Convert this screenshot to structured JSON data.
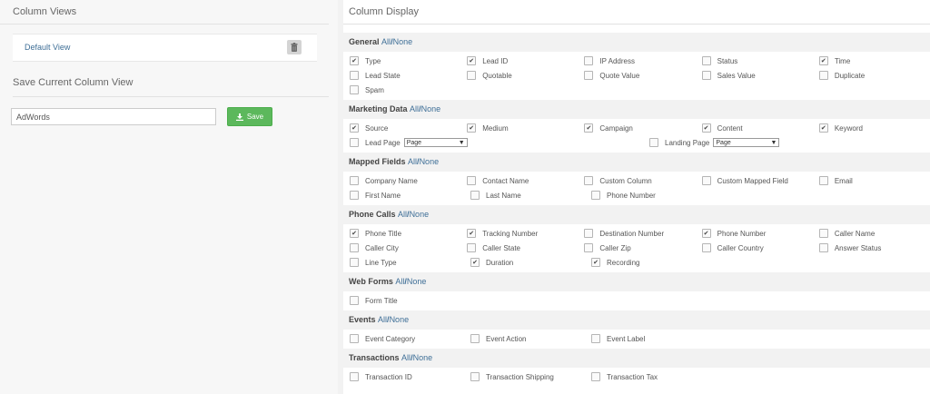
{
  "column_views": {
    "title": "Column Views",
    "default_view": "Default View"
  },
  "save_view": {
    "title": "Save Current Column View",
    "input_value": "AdWords",
    "save_label": "Save"
  },
  "column_display": {
    "title": "Column Display",
    "all_label": "All",
    "none_label": "None",
    "general": {
      "name": "General",
      "rows": [
        [
          {
            "label": "Type",
            "checked": true
          },
          {
            "label": "Lead ID",
            "checked": true
          },
          {
            "label": "IP Address",
            "checked": false
          },
          {
            "label": "Status",
            "checked": false
          },
          {
            "label": "Time",
            "checked": true
          }
        ],
        [
          {
            "label": "Lead State",
            "checked": false
          },
          {
            "label": "Quotable",
            "checked": false
          },
          {
            "label": "Quote Value",
            "checked": false
          },
          {
            "label": "Sales Value",
            "checked": false
          },
          {
            "label": "Duplicate",
            "checked": false
          }
        ],
        [
          {
            "label": "Spam",
            "checked": false
          }
        ]
      ]
    },
    "marketing": {
      "name": "Marketing Data",
      "row1": [
        {
          "label": "Source",
          "checked": true
        },
        {
          "label": "Medium",
          "checked": true
        },
        {
          "label": "Campaign",
          "checked": true
        },
        {
          "label": "Content",
          "checked": true
        },
        {
          "label": "Keyword",
          "checked": true
        }
      ],
      "lead_page": {
        "label": "Lead Page",
        "checked": false,
        "select": "Page"
      },
      "landing_page": {
        "label": "Landing Page",
        "checked": false,
        "select": "Page"
      }
    },
    "mapped": {
      "name": "Mapped Fields",
      "rows": [
        [
          {
            "label": "Company Name",
            "checked": false
          },
          {
            "label": "Contact Name",
            "checked": false
          },
          {
            "label": "Custom Column",
            "checked": false
          },
          {
            "label": "Custom Mapped Field",
            "checked": false
          },
          {
            "label": "Email",
            "checked": false
          }
        ],
        [
          {
            "label": "First Name",
            "checked": false
          },
          {
            "label": "Last Name",
            "checked": false
          },
          {
            "label": "Phone Number",
            "checked": false
          }
        ]
      ]
    },
    "phone": {
      "name": "Phone Calls",
      "rows": [
        [
          {
            "label": "Phone Title",
            "checked": true
          },
          {
            "label": "Tracking Number",
            "checked": true
          },
          {
            "label": "Destination Number",
            "checked": false
          },
          {
            "label": "Phone Number",
            "checked": true
          },
          {
            "label": "Caller Name",
            "checked": false
          }
        ],
        [
          {
            "label": "Caller City",
            "checked": false
          },
          {
            "label": "Caller State",
            "checked": false
          },
          {
            "label": "Caller Zip",
            "checked": false
          },
          {
            "label": "Caller Country",
            "checked": false
          },
          {
            "label": "Answer Status",
            "checked": false
          }
        ],
        [
          {
            "label": "Line Type",
            "checked": false
          },
          {
            "label": "Duration",
            "checked": true
          },
          {
            "label": "Recording",
            "checked": true
          }
        ]
      ]
    },
    "webforms": {
      "name": "Web Forms",
      "rows": [
        [
          {
            "label": "Form Title",
            "checked": false
          }
        ]
      ]
    },
    "events": {
      "name": "Events",
      "rows": [
        [
          {
            "label": "Event Category",
            "checked": false
          },
          {
            "label": "Event Action",
            "checked": false
          },
          {
            "label": "Event Label",
            "checked": false
          }
        ]
      ]
    },
    "transactions": {
      "name": "Transactions",
      "rows": [
        [
          {
            "label": "Transaction ID",
            "checked": false
          },
          {
            "label": "Transaction Shipping",
            "checked": false
          },
          {
            "label": "Transaction Tax",
            "checked": false
          }
        ]
      ]
    }
  },
  "icons": {
    "trash": "trash-icon",
    "download": "download-icon",
    "check": "check-icon",
    "dropdown": "caret-down-icon"
  }
}
